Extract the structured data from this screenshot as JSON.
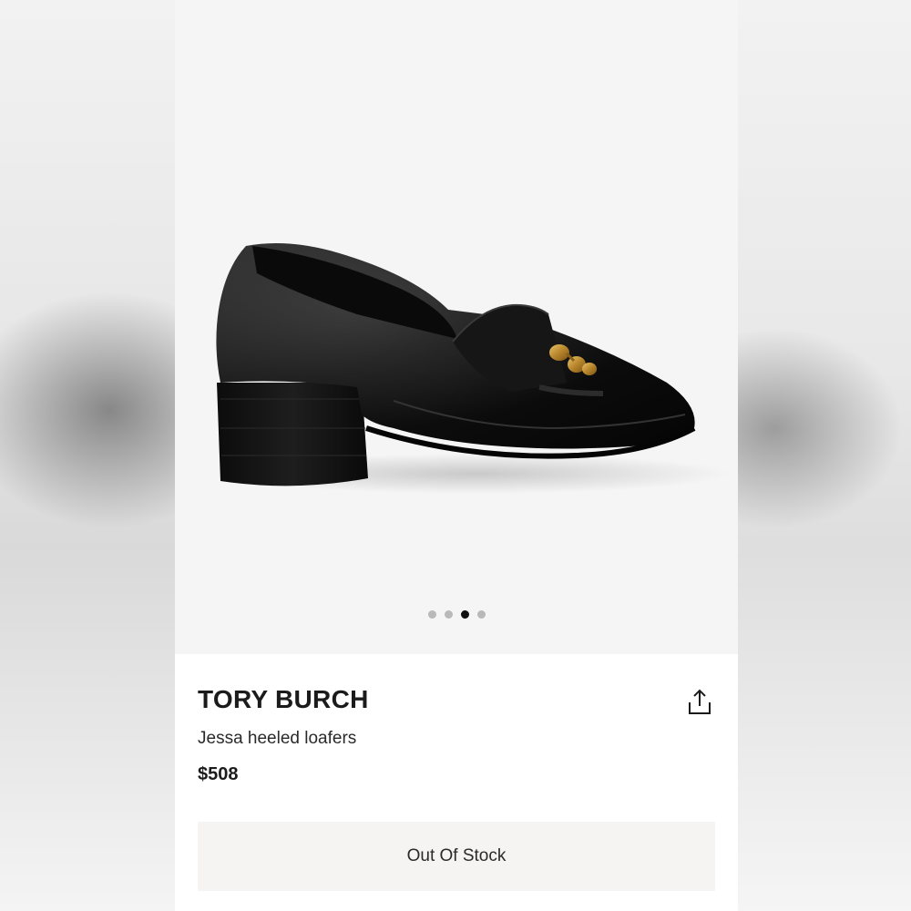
{
  "product": {
    "brand": "TORY BURCH",
    "name": "Jessa heeled loafers",
    "price": "$508"
  },
  "gallery": {
    "image_count": 4,
    "active_index": 2
  },
  "actions": {
    "stock_label": "Out Of Stock",
    "share_icon": "share-icon"
  },
  "colors": {
    "text": "#1b1b1b",
    "button_bg": "#f5f4f2",
    "gallery_bg": "#f5f5f5",
    "dot_active": "#111111",
    "dot_inactive": "#b9b9b9"
  }
}
